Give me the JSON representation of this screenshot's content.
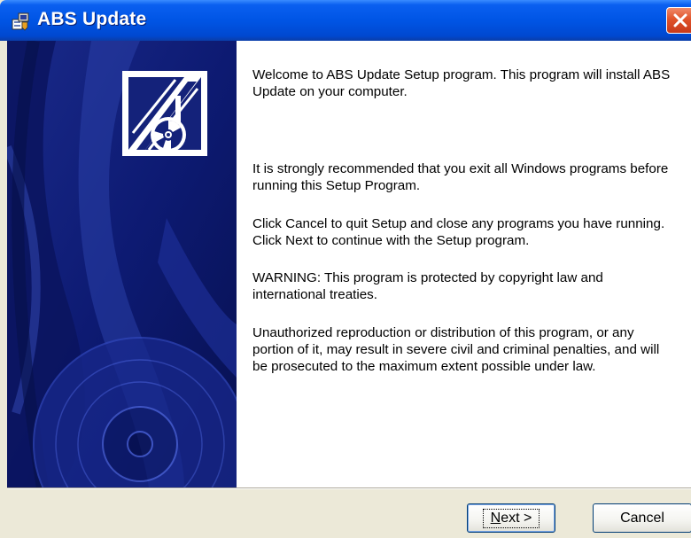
{
  "window": {
    "title": "ABS Update",
    "title_icon": "installer-icon",
    "close_icon": "close-icon"
  },
  "side_panel": {
    "logo_icon": "abs-logo-with-cd-icon",
    "background_art": "cd-disc-graphic"
  },
  "content": {
    "paragraphs": [
      "Welcome to ABS Update Setup program.  This program will install ABS Update on your computer.",
      "It is strongly recommended that you exit all Windows programs before running this Setup Program.",
      "Click Cancel to quit Setup and close any programs you have running.  Click Next to continue with the Setup program.",
      "WARNING: This program is protected by copyright law and international treaties.",
      "Unauthorized reproduction or distribution of this program, or any portion of it, may result in severe civil and criminal penalties, and will be prosecuted to the maximum extent possible under law."
    ]
  },
  "buttons": {
    "next_mnemonic": "N",
    "next_rest": "ext >",
    "cancel": "Cancel"
  },
  "colors": {
    "titlebar": "#0055e5",
    "side_panel": "#0a1668",
    "dialog_face": "#ece9d8",
    "close_button": "#e0532a"
  }
}
